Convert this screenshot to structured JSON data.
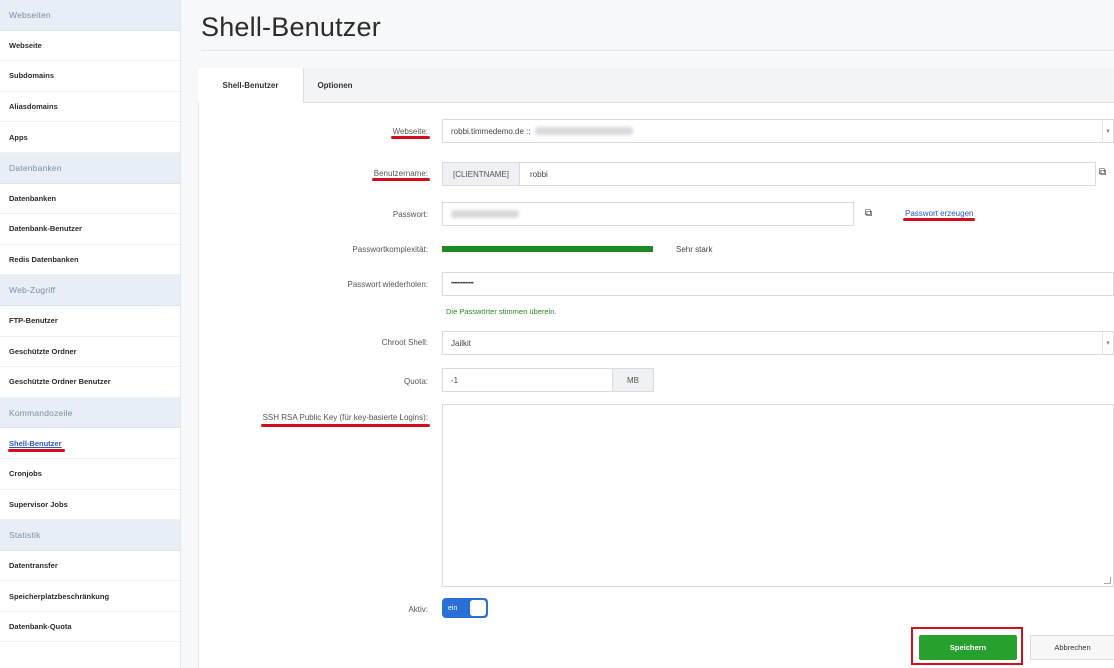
{
  "sidebar": {
    "items": [
      {
        "type": "header",
        "label": "Webseiten"
      },
      {
        "type": "link",
        "label": "Webseite"
      },
      {
        "type": "link",
        "label": "Subdomains"
      },
      {
        "type": "link",
        "label": "Aliasdomains"
      },
      {
        "type": "link",
        "label": "Apps"
      },
      {
        "type": "header",
        "label": "Datenbanken"
      },
      {
        "type": "link",
        "label": "Datenbanken"
      },
      {
        "type": "link",
        "label": "Datenbank-Benutzer"
      },
      {
        "type": "link",
        "label": "Redis Datenbanken"
      },
      {
        "type": "header",
        "label": "Web-Zugriff"
      },
      {
        "type": "link",
        "label": "FTP-Benutzer"
      },
      {
        "type": "link",
        "label": "Geschützte Ordner"
      },
      {
        "type": "link",
        "label": "Geschützte Ordner Benutzer"
      },
      {
        "type": "header",
        "label": "Kommandozeile"
      },
      {
        "type": "link",
        "label": "Shell-Benutzer",
        "active": true
      },
      {
        "type": "link",
        "label": "Cronjobs"
      },
      {
        "type": "link",
        "label": "Supervisor Jobs"
      },
      {
        "type": "header",
        "label": "Statistik"
      },
      {
        "type": "link",
        "label": "Datentransfer"
      },
      {
        "type": "link",
        "label": "Speicherplatzbeschränkung"
      },
      {
        "type": "link",
        "label": "Datenbank-Quota"
      }
    ]
  },
  "page": {
    "title": "Shell-Benutzer"
  },
  "tabs": [
    {
      "label": "Shell-Benutzer",
      "active": true
    },
    {
      "label": "Optionen",
      "active": false
    }
  ],
  "form": {
    "website": {
      "label": "Webseite:",
      "value": "robbi.timmedemo.de :: "
    },
    "username": {
      "label": "Benutzername:",
      "prefix": "[CLIENTNAME]",
      "value": "robbi"
    },
    "password": {
      "label": "Passwort:",
      "generate_link": "Passwort erzeugen"
    },
    "complexity": {
      "label": "Passwortkomplexität:",
      "value": "Sehr stark",
      "level": 1.0
    },
    "repeat": {
      "label": "Passwort wiederholen:",
      "value": "••••••••••••••",
      "match_text": "Die Passwörter stimmen überein."
    },
    "chroot": {
      "label": "Chroot Shell:",
      "value": "Jailkit"
    },
    "quota": {
      "label": "Quota:",
      "value": "-1",
      "unit": "MB"
    },
    "ssh_key": {
      "label": "SSH RSA Public Key (für key-basierte Logins):",
      "value": ""
    },
    "active": {
      "label": "Aktiv:",
      "toggle_text": "ein",
      "checked": true
    }
  },
  "buttons": {
    "save": "Speichern",
    "cancel": "Abbrechen"
  },
  "colors": {
    "highlight": "#d40d1d",
    "save": "#27a02e",
    "link": "#2a57c6",
    "strength": "#1f8a24"
  },
  "icons": {
    "copy": "copy-icon",
    "dropdown": "chevron-down-icon"
  }
}
